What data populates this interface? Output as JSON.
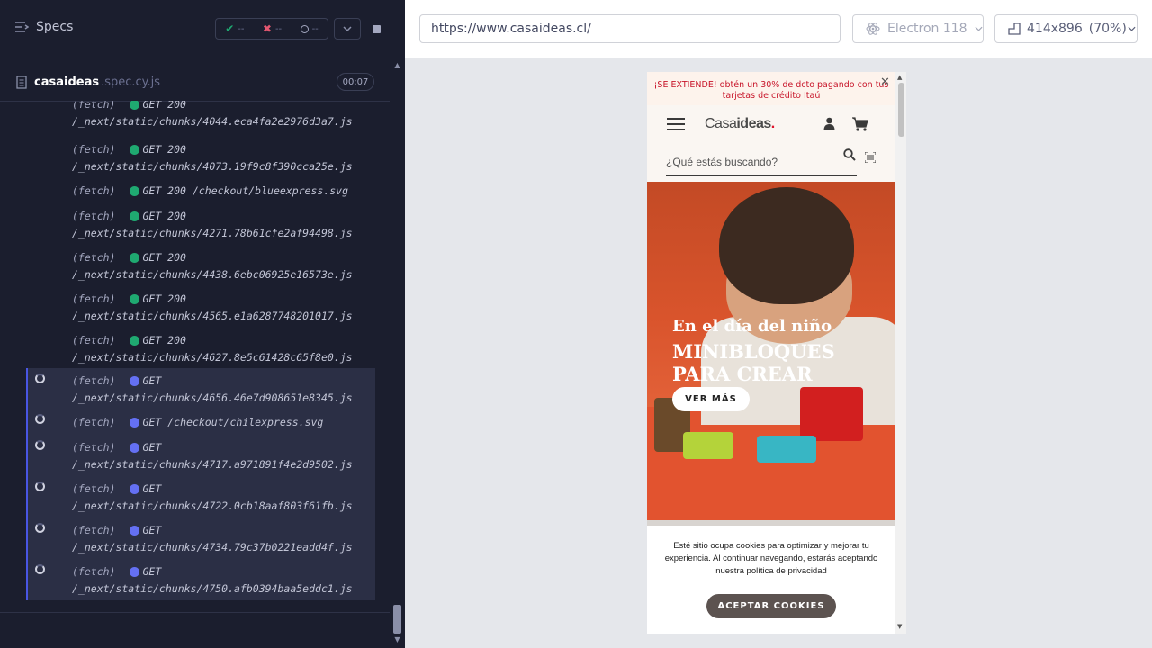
{
  "runner": {
    "specs_label": "Specs",
    "stats": {
      "passed": "--",
      "failed": "--",
      "pending": "--"
    },
    "spec": {
      "name": "casaideas",
      "ext": ".spec.cy.js",
      "time": "00:07"
    }
  },
  "log": {
    "fetch_label": "(fetch)",
    "entries": [
      {
        "state": "ok",
        "method": "GET 200",
        "path": "/_next/static/chunks/4044.eca4fa2e2976d3a7.js"
      },
      {
        "state": "ok",
        "method": "GET 200",
        "path": "/_next/static/chunks/4073.19f9c8f390cca25e.js"
      },
      {
        "state": "ok",
        "method": "GET 200",
        "path": "/checkout/blueexpress.svg"
      },
      {
        "state": "ok",
        "method": "GET 200",
        "path": "/_next/static/chunks/4271.78b61cfe2af94498.js"
      },
      {
        "state": "ok",
        "method": "GET 200",
        "path": "/_next/static/chunks/4438.6ebc06925e16573e.js"
      },
      {
        "state": "ok",
        "method": "GET 200",
        "path": "/_next/static/chunks/4565.e1a6287748201017.js"
      },
      {
        "state": "ok",
        "method": "GET 200",
        "path": "/_next/static/chunks/4627.8e5c61428c65f8e0.js"
      },
      {
        "state": "pend",
        "method": "GET",
        "path": "/_next/static/chunks/4656.46e7d908651e8345.js"
      },
      {
        "state": "pend",
        "method": "GET",
        "path": "/checkout/chilexpress.svg"
      },
      {
        "state": "pend",
        "method": "GET",
        "path": "/_next/static/chunks/4717.a971891f4e2d9502.js"
      },
      {
        "state": "pend",
        "method": "GET",
        "path": "/_next/static/chunks/4722.0cb18aaf803f61fb.js"
      },
      {
        "state": "pend",
        "method": "GET",
        "path": "/_next/static/chunks/4734.79c37b0221eadd4f.js"
      },
      {
        "state": "pend",
        "method": "GET",
        "path": "/_next/static/chunks/4750.afb0394baa5eddc1.js"
      }
    ]
  },
  "browser_bar": {
    "url": "https://www.casaideas.cl/",
    "browser": "Electron 118",
    "viewport": "414x896",
    "zoom": "(70%)"
  },
  "app": {
    "promo": "¡SE EXTIENDE! obtén un 30% de dcto pagando con tus tarjetas de crédito Itaú",
    "logo_left": "Casa",
    "logo_right": "ideas",
    "logo_dot": ".",
    "search_placeholder": "¿Qué estás buscando?",
    "hero_line1": "En el día del niño",
    "hero_line2": "MINIBLOQUES",
    "hero_line3": "PARA CREAR",
    "hero_button": "VER MÁS",
    "cookies_text": "Esté sitio ocupa cookies para optimizar y mejorar tu experiencia. Al continuar navegando, estarás aceptando nuestra política de privacidad",
    "cookies_button": "ACEPTAR COOKIES"
  }
}
